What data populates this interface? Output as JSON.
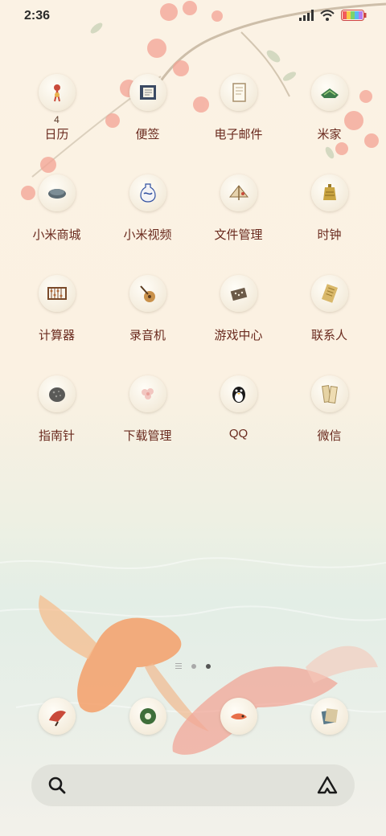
{
  "status": {
    "time": "2:36"
  },
  "apps": [
    {
      "label": "日历",
      "badge": "4",
      "icon": "calendar-icon"
    },
    {
      "label": "便签",
      "icon": "notes-icon"
    },
    {
      "label": "电子邮件",
      "icon": "email-icon"
    },
    {
      "label": "米家",
      "icon": "mijia-icon"
    },
    {
      "label": "小米商城",
      "icon": "mi-store-icon"
    },
    {
      "label": "小米视频",
      "icon": "mi-video-icon"
    },
    {
      "label": "文件管理",
      "icon": "file-manager-icon"
    },
    {
      "label": "时钟",
      "icon": "clock-icon"
    },
    {
      "label": "计算器",
      "icon": "calculator-icon"
    },
    {
      "label": "录音机",
      "icon": "recorder-icon"
    },
    {
      "label": "游戏中心",
      "icon": "game-center-icon"
    },
    {
      "label": "联系人",
      "icon": "contacts-icon"
    },
    {
      "label": "指南针",
      "icon": "compass-icon"
    },
    {
      "label": "下载管理",
      "icon": "downloads-icon"
    },
    {
      "label": "QQ",
      "icon": "qq-icon"
    },
    {
      "label": "微信",
      "icon": "wechat-icon"
    }
  ],
  "dock": [
    {
      "icon": "phone-icon"
    },
    {
      "icon": "messages-icon"
    },
    {
      "icon": "browser-icon"
    },
    {
      "icon": "gallery-icon"
    }
  ],
  "colors": {
    "label": "#6a2a1e",
    "blossom": "#f08a7a",
    "fish": "#f5a070"
  }
}
